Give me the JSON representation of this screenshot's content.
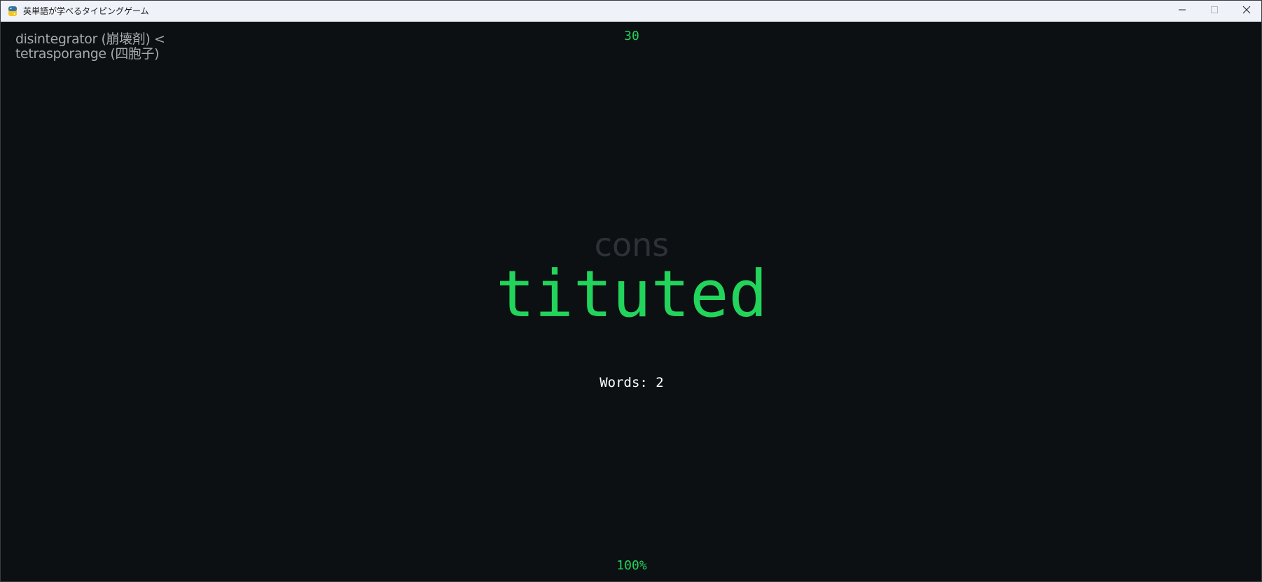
{
  "window": {
    "title": "英単語が学べるタイピングゲーム",
    "icon": "python-icon",
    "controls": [
      "minimize-icon",
      "maximize-icon",
      "close-icon"
    ]
  },
  "game": {
    "timer": "30",
    "history": [
      "disintegrator (崩壊剤) <",
      "tetrasporange (四胞子)"
    ],
    "typed_part": "cons",
    "remaining_part": "tituted",
    "words_count_label": "Words: 2",
    "accuracy": "100%"
  },
  "colors": {
    "background": "#0d1012",
    "accent_green": "#22d45b",
    "typed_gray": "#2e3236",
    "history_gray": "#a7a9ab",
    "text_white": "#ffffff"
  }
}
